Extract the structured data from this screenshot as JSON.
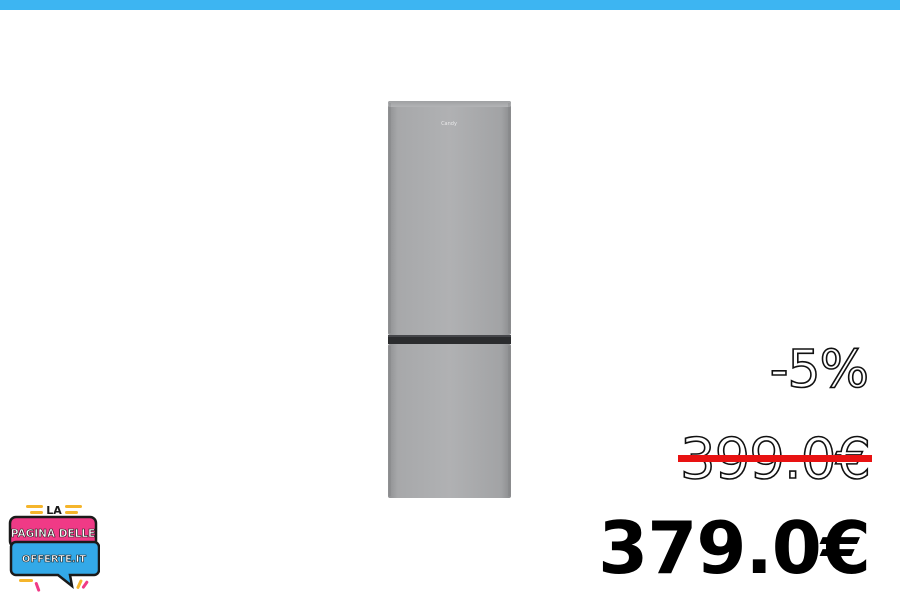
{
  "colors": {
    "top_bar": "#3db5f2",
    "strike_line": "#e81212",
    "appliance_body": "#a9aaab",
    "logo_pink": "#f03a86",
    "logo_blue": "#33a9e8",
    "logo_yellow": "#f5b52b"
  },
  "product": {
    "brand_mark": "Candy"
  },
  "pricing": {
    "discount": "-5%",
    "old_price": "399.0€",
    "new_price": "379.0€"
  },
  "logo": {
    "line1": "LA",
    "line2": "PAGINA DELLE",
    "line3": "OFFERTE.IT"
  }
}
